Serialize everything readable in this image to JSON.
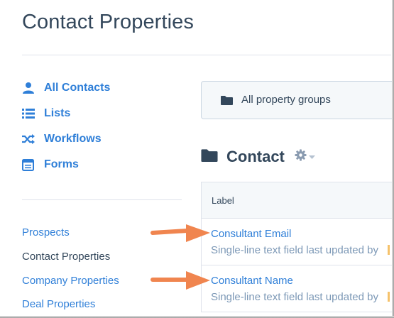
{
  "page": {
    "title": "Contact Properties"
  },
  "sidebar": {
    "nav": [
      {
        "label": "All Contacts",
        "icon": "person-icon"
      },
      {
        "label": "Lists",
        "icon": "list-icon"
      },
      {
        "label": "Workflows",
        "icon": "shuffle-icon"
      },
      {
        "label": "Forms",
        "icon": "form-icon"
      }
    ],
    "links": [
      {
        "label": "Prospects"
      },
      {
        "label": "Contact Properties"
      },
      {
        "label": "Company Properties"
      },
      {
        "label": "Deal Properties"
      }
    ]
  },
  "group_filter": {
    "value": "All property groups",
    "icon": "folder-icon"
  },
  "section": {
    "title": "Contact",
    "icon": "folder-icon",
    "settings_icon": "gear-icon"
  },
  "table": {
    "columns": [
      "Label"
    ],
    "rows": [
      {
        "name": "Consultant Email",
        "description": "Single-line text field last updated by"
      },
      {
        "name": "Consultant Name",
        "description": "Single-line text field last updated by"
      }
    ]
  },
  "colors": {
    "link": "#2f7fd8",
    "text": "#33475b",
    "arrow": "#f0854f"
  }
}
